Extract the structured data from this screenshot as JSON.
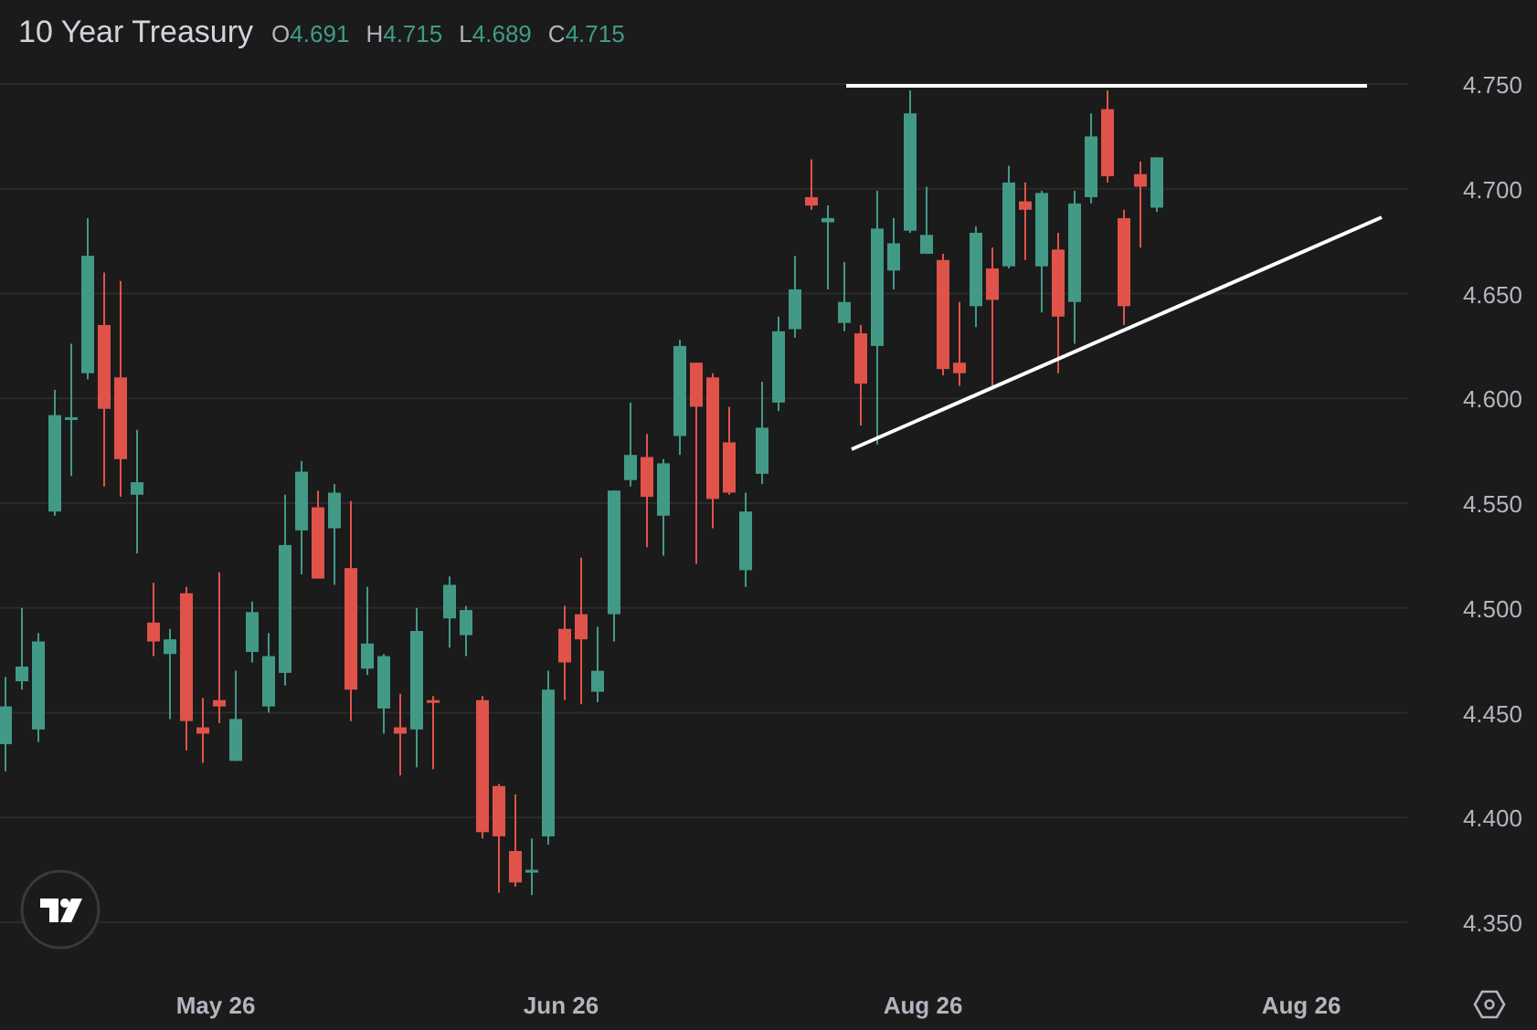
{
  "header": {
    "title": "10 Year Treasury",
    "ohlc": [
      {
        "label": "O",
        "value": "4.691"
      },
      {
        "label": "H",
        "value": "4.715"
      },
      {
        "label": "L",
        "value": "4.689"
      },
      {
        "label": "C",
        "value": "4.715"
      }
    ]
  },
  "chart_data": {
    "type": "candlestick",
    "grid": true,
    "ylim": [
      4.35,
      4.75
    ],
    "yticks": [
      {
        "value": 4.75,
        "label": "4.750"
      },
      {
        "value": 4.7,
        "label": "4.700"
      },
      {
        "value": 4.65,
        "label": "4.650"
      },
      {
        "value": 4.6,
        "label": "4.600"
      },
      {
        "value": 4.55,
        "label": "4.550"
      },
      {
        "value": 4.5,
        "label": "4.500"
      },
      {
        "value": 4.45,
        "label": "4.450"
      },
      {
        "value": 4.4,
        "label": "4.400"
      },
      {
        "value": 4.35,
        "label": "4.350"
      }
    ],
    "categories": [
      null,
      null,
      null,
      null,
      null,
      null,
      null,
      null,
      null,
      null,
      null,
      null,
      null,
      "May 26",
      null,
      null,
      null,
      null,
      null,
      null,
      null,
      null,
      null,
      null,
      null,
      null,
      null,
      null,
      null,
      null,
      null,
      null,
      null,
      null,
      "Jun 26",
      null,
      null,
      null,
      null,
      null,
      null,
      null,
      null,
      null,
      null,
      null,
      null,
      null,
      null,
      null,
      null,
      null,
      null,
      null,
      null,
      null,
      "Aug 26",
      null,
      null,
      null,
      null,
      null,
      null,
      null,
      null,
      null,
      null,
      null,
      null,
      null,
      null,
      null,
      null,
      null,
      null,
      null,
      null,
      null,
      null,
      "Aug 26",
      null,
      null,
      null,
      null,
      null,
      null
    ],
    "ohlc": [
      [
        4.435,
        4.467,
        4.422,
        4.453
      ],
      [
        4.465,
        4.5,
        4.461,
        4.472
      ],
      [
        4.442,
        4.488,
        4.436,
        4.484
      ],
      [
        4.546,
        4.604,
        4.544,
        4.592
      ],
      [
        4.591,
        4.626,
        4.563,
        4.591
      ],
      [
        4.612,
        4.686,
        4.609,
        4.668
      ],
      [
        4.635,
        4.66,
        4.558,
        4.595
      ],
      [
        4.61,
        4.656,
        4.553,
        4.571
      ],
      [
        4.554,
        4.585,
        4.526,
        4.56
      ],
      [
        4.493,
        4.512,
        4.477,
        4.484
      ],
      [
        4.478,
        4.49,
        4.447,
        4.485
      ],
      [
        4.507,
        4.51,
        4.432,
        4.446
      ],
      [
        4.443,
        4.457,
        4.426,
        4.44
      ],
      [
        4.456,
        4.517,
        4.445,
        4.453
      ],
      [
        4.427,
        4.47,
        4.427,
        4.447
      ],
      [
        4.479,
        4.503,
        4.474,
        4.498
      ],
      [
        4.453,
        4.488,
        4.45,
        4.477
      ],
      [
        4.469,
        4.554,
        4.463,
        4.53
      ],
      [
        4.537,
        4.57,
        4.516,
        4.565
      ],
      [
        4.548,
        4.556,
        4.514,
        4.514
      ],
      [
        4.538,
        4.559,
        4.511,
        4.555
      ],
      [
        4.519,
        4.551,
        4.446,
        4.461
      ],
      [
        4.471,
        4.51,
        4.468,
        4.483
      ],
      [
        4.452,
        4.478,
        4.44,
        4.477
      ],
      [
        4.443,
        4.459,
        4.42,
        4.44
      ],
      [
        4.442,
        4.5,
        4.424,
        4.489
      ],
      [
        4.456,
        4.458,
        4.423,
        4.455
      ],
      [
        4.495,
        4.515,
        4.481,
        4.511
      ],
      [
        4.487,
        4.501,
        4.477,
        4.499
      ],
      [
        4.456,
        4.458,
        4.39,
        4.393
      ],
      [
        4.415,
        4.416,
        4.364,
        4.391
      ],
      [
        4.384,
        4.411,
        4.367,
        4.369
      ],
      [
        4.375,
        4.39,
        4.363,
        4.375
      ],
      [
        4.391,
        4.47,
        4.387,
        4.461
      ],
      [
        4.49,
        4.501,
        4.456,
        4.474
      ],
      [
        4.497,
        4.524,
        4.454,
        4.485
      ],
      [
        4.46,
        4.491,
        4.455,
        4.47
      ],
      [
        4.497,
        4.556,
        4.484,
        4.556
      ],
      [
        4.561,
        4.598,
        4.558,
        4.573
      ],
      [
        4.572,
        4.583,
        4.529,
        4.553
      ],
      [
        4.544,
        4.571,
        4.525,
        4.569
      ],
      [
        4.582,
        4.628,
        4.573,
        4.625
      ],
      [
        4.617,
        4.617,
        4.521,
        4.596
      ],
      [
        4.61,
        4.612,
        4.538,
        4.552
      ],
      [
        4.579,
        4.596,
        4.554,
        4.555
      ],
      [
        4.518,
        4.555,
        4.51,
        4.546
      ],
      [
        4.564,
        4.608,
        4.559,
        4.586
      ],
      [
        4.598,
        4.639,
        4.594,
        4.632
      ],
      [
        4.633,
        4.668,
        4.629,
        4.652
      ],
      [
        4.696,
        4.714,
        4.69,
        4.692
      ],
      [
        4.684,
        4.692,
        4.652,
        4.686
      ],
      [
        4.636,
        4.665,
        4.632,
        4.646
      ],
      [
        4.631,
        4.635,
        4.587,
        4.607
      ],
      [
        4.625,
        4.699,
        4.578,
        4.681
      ],
      [
        4.661,
        4.686,
        4.652,
        4.674
      ],
      [
        4.68,
        4.747,
        4.679,
        4.736
      ],
      [
        4.669,
        4.701,
        4.669,
        4.678
      ],
      [
        4.666,
        4.669,
        4.611,
        4.614
      ],
      [
        4.617,
        4.646,
        4.606,
        4.612
      ],
      [
        4.644,
        4.682,
        4.634,
        4.679
      ],
      [
        4.662,
        4.672,
        4.605,
        4.647
      ],
      [
        4.663,
        4.711,
        4.662,
        4.703
      ],
      [
        4.694,
        4.703,
        4.666,
        4.69
      ],
      [
        4.663,
        4.699,
        4.641,
        4.698
      ],
      [
        4.671,
        4.679,
        4.612,
        4.639
      ],
      [
        4.646,
        4.699,
        4.626,
        4.693
      ],
      [
        4.696,
        4.736,
        4.693,
        4.725
      ],
      [
        4.738,
        4.747,
        4.703,
        4.706
      ],
      [
        4.686,
        4.69,
        4.635,
        4.644
      ],
      [
        4.707,
        4.713,
        4.672,
        4.701
      ],
      [
        4.691,
        4.715,
        4.689,
        4.715
      ],
      null,
      null,
      null,
      null,
      null,
      null,
      null,
      null,
      null,
      null,
      null,
      null,
      null,
      null,
      null
    ]
  }
}
